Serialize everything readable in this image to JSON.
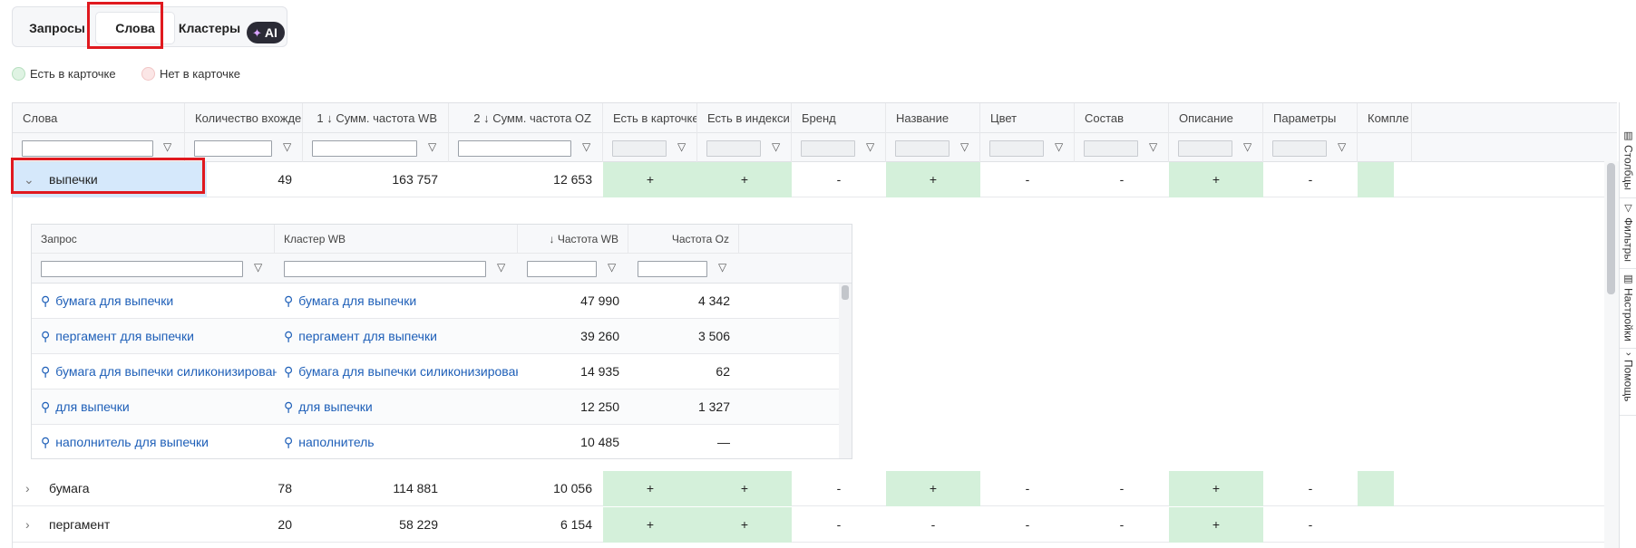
{
  "tabs": {
    "requests": "Запросы",
    "words": "Слова",
    "clusters": "Кластеры",
    "ai_badge": "AI"
  },
  "legend": {
    "in_card": "Есть в карточке",
    "not_in_card": "Нет в карточке"
  },
  "columns": [
    {
      "label": "Слова"
    },
    {
      "label": "Количество вхожде..."
    },
    {
      "label": "1  ↓ Сумм. частота WB"
    },
    {
      "label": "2  ↓ Сумм. частота OZ"
    },
    {
      "label": "Есть в карточке"
    },
    {
      "label": "Есть в индекси..."
    },
    {
      "label": "Бренд"
    },
    {
      "label": "Название"
    },
    {
      "label": "Цвет"
    },
    {
      "label": "Состав"
    },
    {
      "label": "Описание"
    },
    {
      "label": "Параметры"
    },
    {
      "label": "Компле"
    }
  ],
  "rows": [
    {
      "word": "выпечки",
      "count": "49",
      "wb": "163 757",
      "oz": "12 653",
      "in_card": "+",
      "indexed": "+",
      "brand": "-",
      "name": "+",
      "color": "-",
      "composition": "-",
      "description": "+",
      "params": "-"
    },
    {
      "word": "бумага",
      "count": "78",
      "wb": "114 881",
      "oz": "10 056",
      "in_card": "+",
      "indexed": "+",
      "brand": "-",
      "name": "+",
      "color": "-",
      "composition": "-",
      "description": "+",
      "params": "-"
    },
    {
      "word": "пергамент",
      "count": "20",
      "wb": "58 229",
      "oz": "6 154",
      "in_card": "+",
      "indexed": "+",
      "brand": "-",
      "name": "-",
      "color": "-",
      "composition": "-",
      "description": "+",
      "params": "-"
    }
  ],
  "nested": {
    "columns": {
      "query": "Запрос",
      "cluster": "Кластер WB",
      "freq_wb": "↓ Частота WB",
      "freq_oz": "Частота Oz"
    },
    "rows": [
      {
        "query": "бумага для выпечки",
        "cluster": "бумага для выпечки",
        "wb": "47 990",
        "oz": "4 342"
      },
      {
        "query": "пергамент для выпечки",
        "cluster": "пергамент для выпечки",
        "wb": "39 260",
        "oz": "3 506"
      },
      {
        "query": "бумага для выпечки силиконизированная",
        "cluster": "бумага для выпечки силиконизированная",
        "wb": "14 935",
        "oz": "62"
      },
      {
        "query": "для выпечки",
        "cluster": "для выпечки",
        "wb": "12 250",
        "oz": "1 327"
      },
      {
        "query": "наполнитель для выпечки",
        "cluster": "наполнитель",
        "wb": "10 485",
        "oz": "—"
      }
    ]
  },
  "side_panel": {
    "columns": "Столбцы",
    "filters": "Фильтры",
    "settings": "Настройки",
    "help": "Помощь"
  }
}
